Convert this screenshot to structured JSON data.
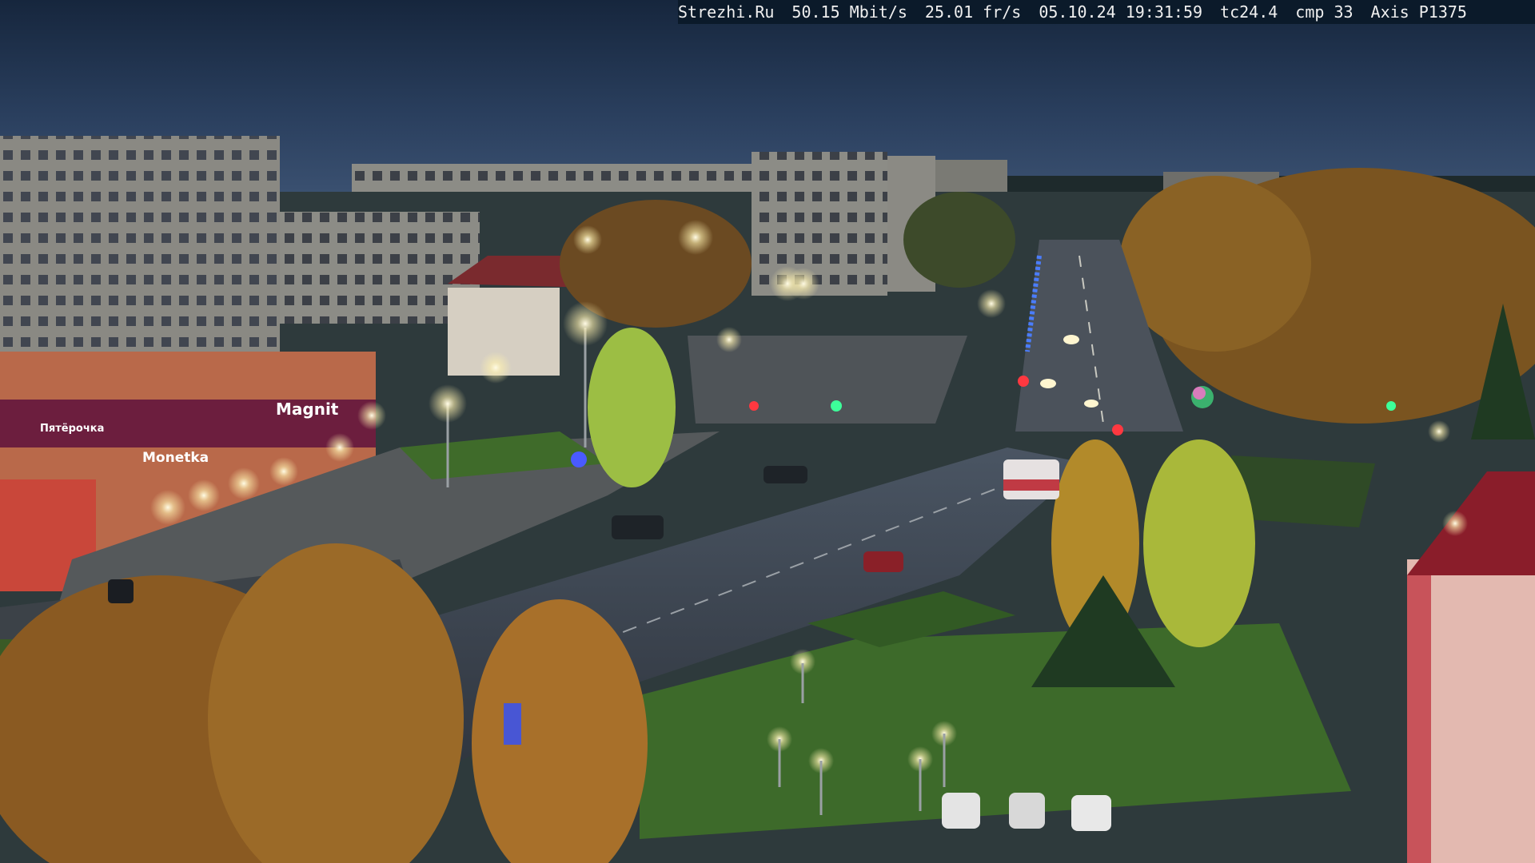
{
  "overlay": {
    "site": "Strezhi.Ru",
    "bitrate": "50.15 Mbit/s",
    "framerate": "25.01 fr/s",
    "datetime": "05.10.24 19:31:59",
    "tc": "tc24.4",
    "cmp": "cmp 33",
    "camera": "Axis P1375"
  },
  "signs": {
    "store_main": "Magnit",
    "store_left": "Monetka",
    "store_far": "Пятёрочка"
  },
  "scene": {
    "subject": "night aerial street view with birch trees, apartment blocks, a square and an intersection",
    "colors": {
      "sky": "#1d2f4a",
      "foliage": "#b07a2a",
      "grass": "#3d6a2a",
      "road": "#3a4450",
      "streetlight": "#fff8d8"
    }
  }
}
